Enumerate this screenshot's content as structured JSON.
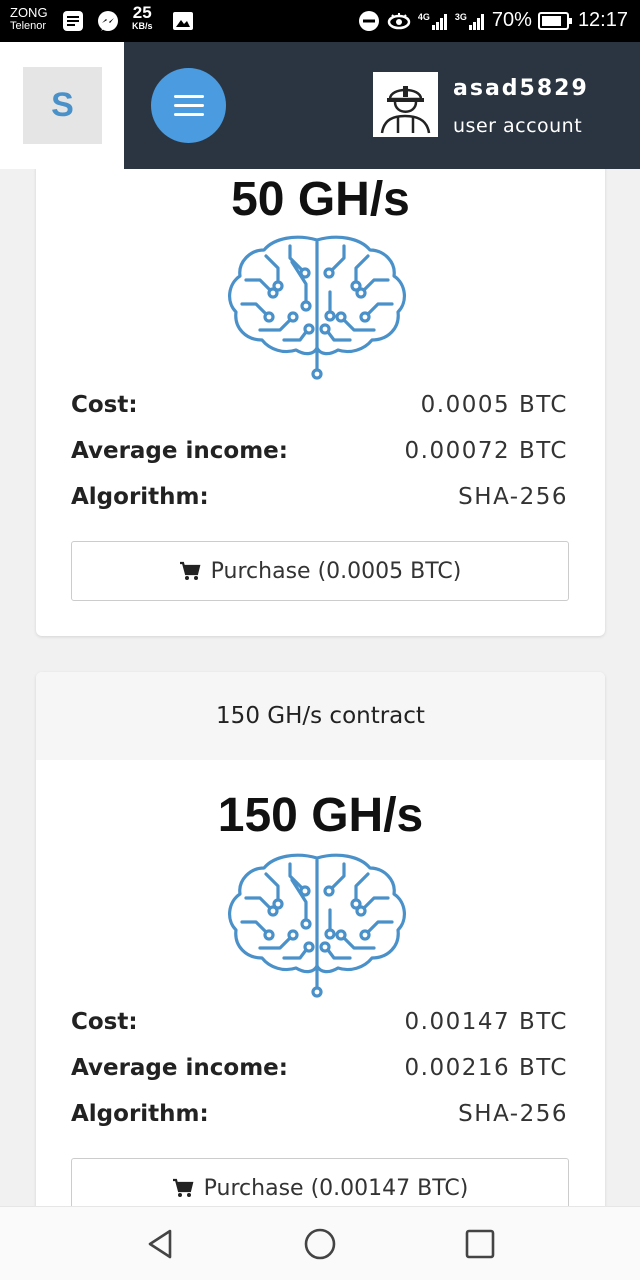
{
  "status_bar": {
    "carrier_primary": "ZONG",
    "carrier_secondary": "Telenor",
    "net_speed_value": "25",
    "net_speed_unit": "KB/s",
    "signal_1_label": "4G",
    "signal_2_label": "3G",
    "battery": "70%",
    "time": "12:17"
  },
  "header": {
    "brand_letter": "S",
    "username": "asad5829",
    "account_type": "user account"
  },
  "contracts": [
    {
      "hashrate": "50 GH/s",
      "cost_label": "Cost:",
      "cost": "0.0005 BTC",
      "income_label": "Average income:",
      "income": "0.00072 BTC",
      "algorithm_label": "Algorithm:",
      "algorithm": "SHA-256",
      "purchase_label": "Purchase (0.0005 BTC)"
    },
    {
      "title": "150 GH/s contract",
      "hashrate": "150 GH/s",
      "cost_label": "Cost:",
      "cost": "0.00147 BTC",
      "income_label": "Average income:",
      "income": "0.00216 BTC",
      "algorithm_label": "Algorithm:",
      "algorithm": "SHA-256",
      "purchase_label": "Purchase (0.00147 BTC)"
    }
  ],
  "icons": {
    "brain": "brain-circuit-icon",
    "cart": "cart-icon",
    "menu": "hamburger-menu-icon"
  },
  "colors": {
    "accent_blue": "#4a9be0",
    "header_dark": "#2b3541",
    "brain_blue": "#4a90c9"
  }
}
